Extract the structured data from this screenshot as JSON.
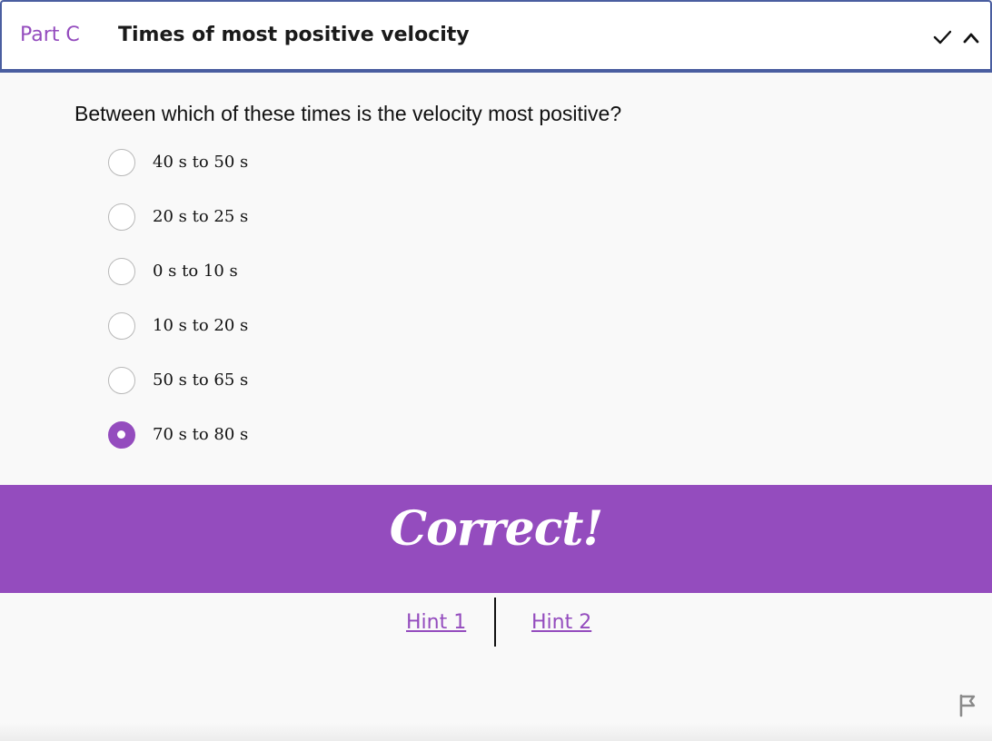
{
  "header": {
    "part_label": "Part C",
    "title": "Times of most positive velocity",
    "icons": [
      "check-icon",
      "chevron-up-icon"
    ]
  },
  "question": {
    "text": "Between which of these times is the velocity most positive?",
    "choices": [
      {
        "label": "40 s to 50 s",
        "selected": false
      },
      {
        "label": "20 s to 25 s",
        "selected": false
      },
      {
        "label": "0 s to 10 s",
        "selected": false
      },
      {
        "label": "10 s to 20 s",
        "selected": false
      },
      {
        "label": "50 s to 65 s",
        "selected": false
      },
      {
        "label": "70 s to 80 s",
        "selected": true
      }
    ]
  },
  "feedback": {
    "text": "Correct!"
  },
  "hints": {
    "hint1": "Hint 1",
    "hint2": "Hint 2"
  },
  "footer": {
    "icon": "flag-icon"
  },
  "colors": {
    "accent": "#944cbe",
    "header_border": "#4a5ea0",
    "background": "#f9f9f9"
  }
}
